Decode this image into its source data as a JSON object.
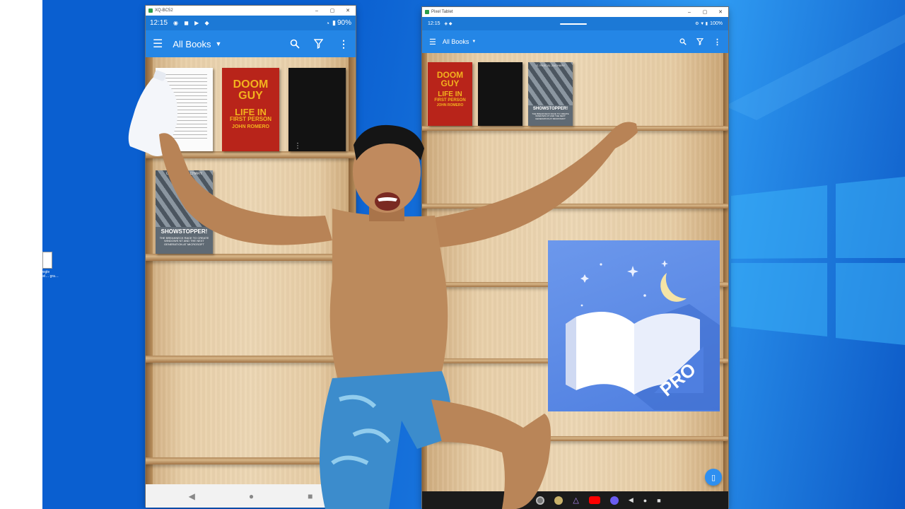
{
  "phone": {
    "window_title": "XQ-BC52",
    "time": "12:15",
    "battery": "90%",
    "appbar_title": "All Books",
    "books": [
      {
        "type": "document"
      },
      {
        "type": "doom",
        "line1": "DOOM",
        "line2": "GUY",
        "line3": "LIFE IN",
        "line4": "FIRST PERSON",
        "author": "JOHN ROMERO"
      },
      {
        "type": "black"
      },
      {
        "type": "showstopper",
        "publisher": "G. PASCAL ZACHARY",
        "title": "SHOWSTOPPER!",
        "subtitle": "THE BREAKNECK RACE TO CREATE WINDOWS NT AND THE NEXT GENERATION AT MICROSOFT"
      }
    ]
  },
  "tablet": {
    "window_title": "Pixel Tablet",
    "time": "12:15",
    "battery": "100%",
    "appbar_title": "All Books"
  },
  "desktop_icon": {
    "label": "Google pixel… gra…"
  },
  "logo": {
    "badge": "PRO"
  },
  "colors": {
    "status_bar": "#1c79d6",
    "app_bar": "#2486e6",
    "desktop": "#0a5fd0"
  }
}
